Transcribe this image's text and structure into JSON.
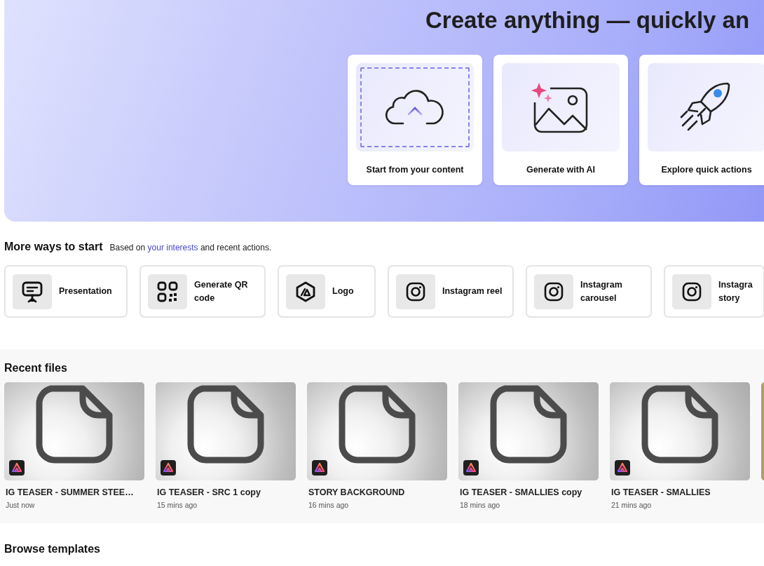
{
  "hero": {
    "title": "Create anything — quickly an",
    "actions": [
      {
        "kind": "upload",
        "label": "Start from your content"
      },
      {
        "kind": "ai",
        "label": "Generate with AI"
      },
      {
        "kind": "quick",
        "label": "Explore quick actions"
      }
    ]
  },
  "more_ways": {
    "heading": "More ways to start",
    "note_before": "Based on ",
    "note_link": "your interests",
    "note_after": " and recent actions.",
    "items": [
      {
        "kind": "presentation",
        "label": "Presentation"
      },
      {
        "kind": "qr",
        "label": "Generate QR code"
      },
      {
        "kind": "logo",
        "label": "Logo"
      },
      {
        "kind": "instagram",
        "label": "Instagram reel"
      },
      {
        "kind": "instagram",
        "label": "Instagram carousel"
      },
      {
        "kind": "instagram",
        "label": "Instagra story"
      }
    ]
  },
  "recent_files": {
    "heading": "Recent files",
    "more_cut_off": true,
    "files": [
      {
        "title": "IG TEASER - SUMMER STEE…",
        "time": "Just now"
      },
      {
        "title": "IG TEASER - SRC 1 copy",
        "time": "15 mins ago"
      },
      {
        "title": "STORY BACKGROUND",
        "time": "16 mins ago"
      },
      {
        "title": "IG TEASER - SMALLIES copy",
        "time": "18 mins ago"
      },
      {
        "title": "IG TEASER - SMALLIES",
        "time": "21 mins ago"
      }
    ]
  },
  "templates": {
    "heading": "Browse templates"
  }
}
